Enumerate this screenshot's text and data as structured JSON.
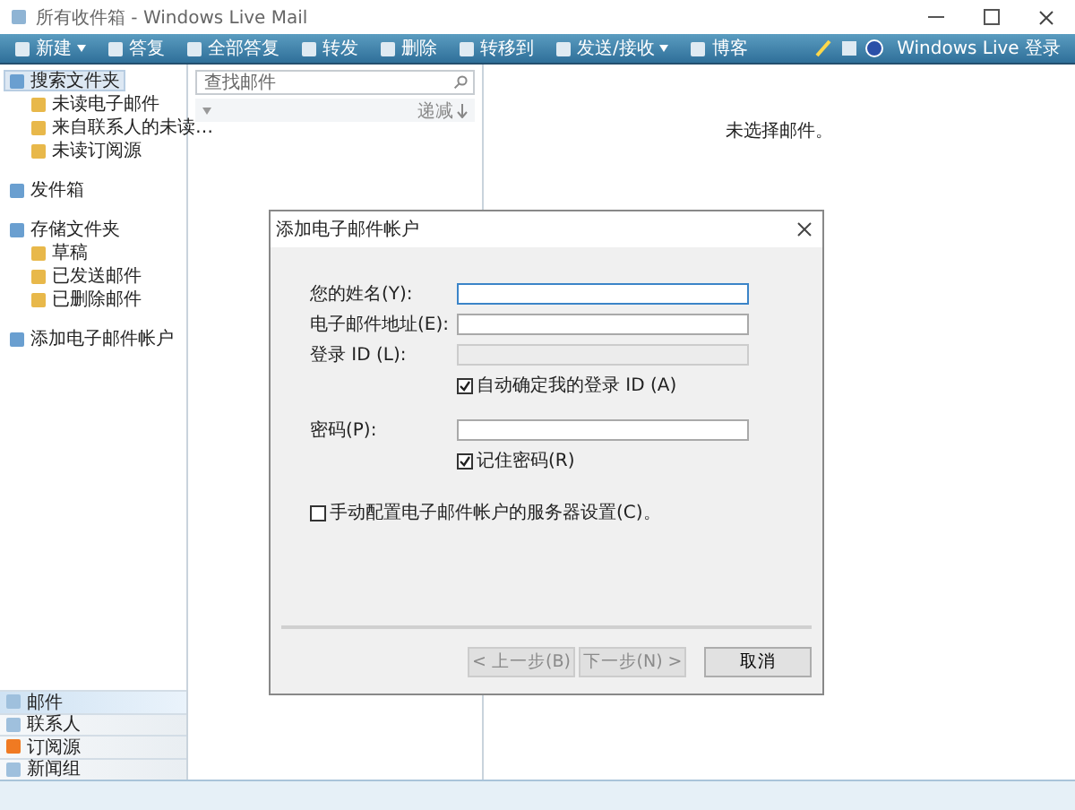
{
  "window": {
    "title": "所有收件箱 - Windows Live Mail"
  },
  "toolbar": {
    "items": [
      {
        "label": "新建",
        "dropdown": true
      },
      {
        "label": "答复",
        "dropdown": false
      },
      {
        "label": "全部答复",
        "dropdown": false
      },
      {
        "label": "转发",
        "dropdown": false
      },
      {
        "label": "删除",
        "dropdown": false
      },
      {
        "label": "转移到",
        "dropdown": false
      },
      {
        "label": "发送/接收",
        "dropdown": true
      },
      {
        "label": "博客",
        "dropdown": false
      }
    ],
    "signin": "Windows Live 登录"
  },
  "sidebar": {
    "items": [
      {
        "label": "搜索文件夹",
        "selected": true,
        "children": [
          {
            "label": "未读电子邮件",
            "selected": false
          },
          {
            "label": "来自联系人的未读…",
            "selected": false
          },
          {
            "label": "未读订阅源",
            "selected": false
          }
        ]
      },
      {
        "label": "发件箱",
        "selected": false
      },
      {
        "label": "存储文件夹",
        "selected": false,
        "children": [
          {
            "label": "草稿",
            "selected": false
          },
          {
            "label": "已发送邮件",
            "selected": false
          },
          {
            "label": "已删除邮件",
            "selected": false
          }
        ]
      },
      {
        "label": "添加电子邮件帐户",
        "selected": false
      }
    ],
    "nav": [
      {
        "label": "邮件",
        "selected": true
      },
      {
        "label": "联系人",
        "selected": false
      },
      {
        "label": "订阅源",
        "selected": false
      },
      {
        "label": "新闻组",
        "selected": false
      }
    ]
  },
  "message_list": {
    "search": {
      "placeholder": "查找邮件"
    },
    "sort": "递减"
  },
  "reading_pane": {
    "message": "未选择邮件。"
  },
  "dialog": {
    "title": "添加电子邮件帐户",
    "rows": [
      {
        "kind": "field",
        "label": "您的姓名(Y):",
        "focused": true,
        "disabled": false
      },
      {
        "kind": "field",
        "label": "电子邮件地址(E):",
        "focused": false,
        "disabled": false
      },
      {
        "kind": "field",
        "label": "登录 ID (L):",
        "focused": false,
        "disabled": true
      },
      {
        "kind": "check",
        "label": "自动确定我的登录 ID (A)",
        "checked": true
      },
      {
        "kind": "field",
        "label": "密码(P):",
        "focused": false,
        "disabled": false
      },
      {
        "kind": "check",
        "label": "记住密码(R)",
        "checked": true
      },
      {
        "kind": "option",
        "label": "手动配置电子邮件帐户的服务器设置(C)。",
        "checked": false
      }
    ],
    "buttons": [
      {
        "label": "< 上一步(B)",
        "disabled": true
      },
      {
        "label": "下一步(N) >",
        "disabled": true
      },
      {
        "label": "取消",
        "disabled": false
      }
    ]
  }
}
